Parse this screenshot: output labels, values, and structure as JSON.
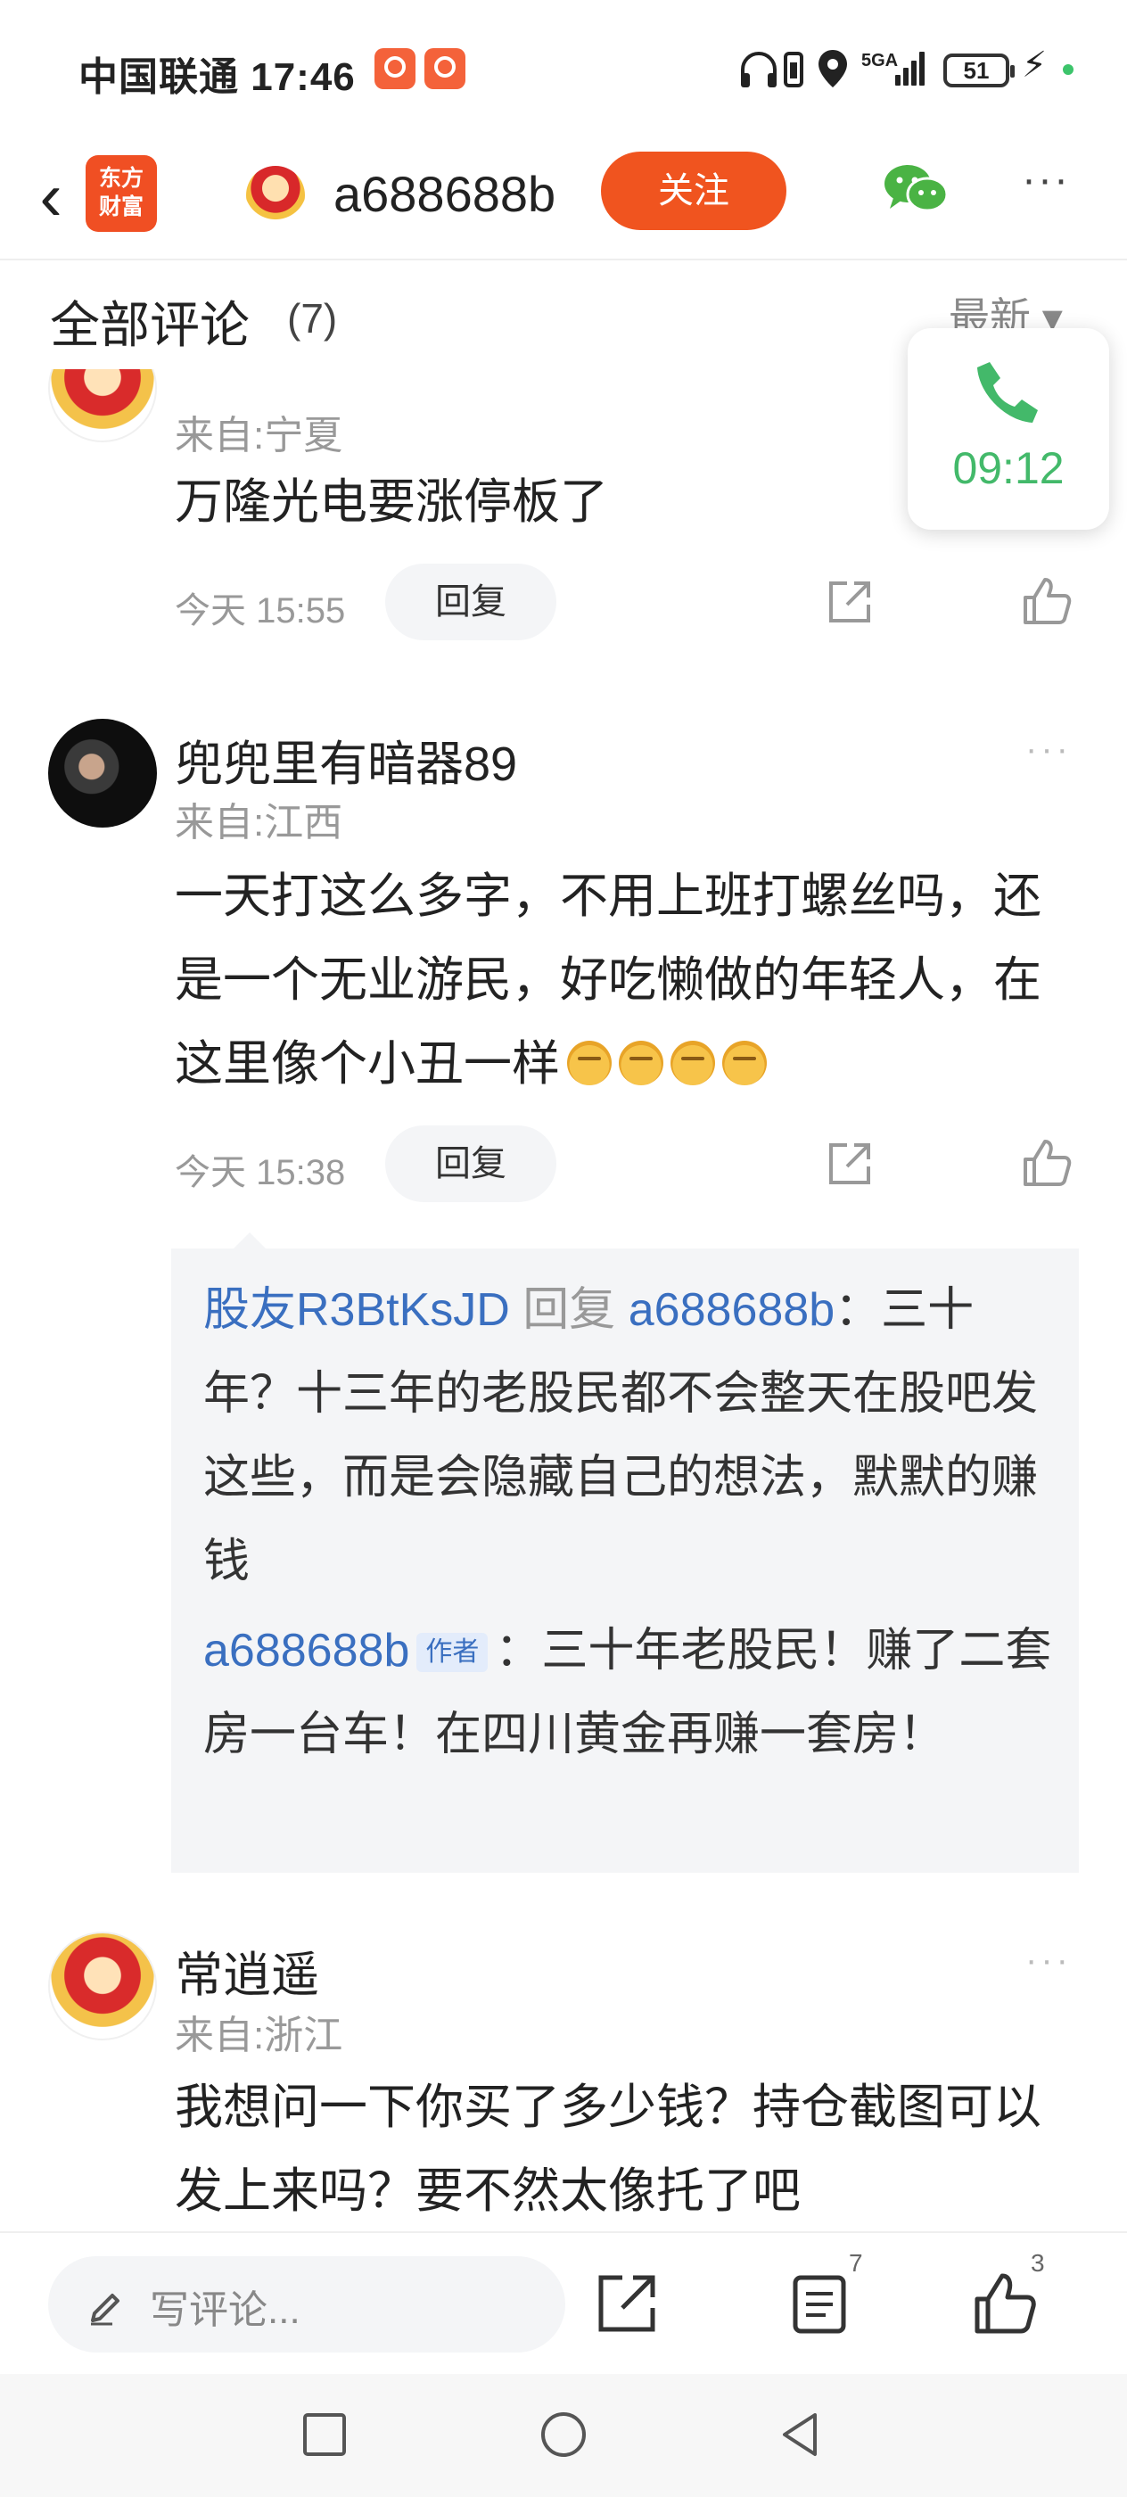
{
  "status_bar": {
    "carrier_time": "中国联通 17:46",
    "network": "5GA",
    "battery": "51",
    "bolt": "⚡"
  },
  "nav": {
    "back_glyph": "‹",
    "brand_logo": "东方\n财富",
    "host_name": "a688688b",
    "follow_label": "关注",
    "more_glyph": "···"
  },
  "comments_header": {
    "title": "全部评论",
    "count": "(7)",
    "sort": "最新 ▾"
  },
  "call_float": {
    "timer": "09:12",
    "accent": "#43b96a"
  },
  "comments": [
    {
      "username": "",
      "location": "来自:宁夏",
      "content": "万隆光电要涨停板了",
      "time": "今天 15:55",
      "reply_label": "回复"
    },
    {
      "username": "兜兜里有暗器89",
      "location": "来自:江西",
      "content": "一天打这么多字，不用上班打螺丝吗，还是一个无业游民，好吃懒做的年轻人，在这里像个小丑一样",
      "time": "今天 15:38",
      "reply_label": "回复",
      "more_glyph": "···",
      "replies": [
        {
          "from": "股友R3BtKsJD",
          "action": "回复",
          "to": "a688688b",
          "text": "：三十年？十三年的老股民都不会整天在股吧发这些，而是会隐藏自己的想法，默默的赚钱"
        },
        {
          "from": "a688688b",
          "tag": "作者",
          "text": "：三十年老股民！赚了二套房一台车！在四川黄金再赚一套房！"
        }
      ]
    },
    {
      "username": "常逍遥",
      "location": "来自:浙江",
      "content": "我想问一下你买了多少钱？持仓截图可以发上来吗？要不然太像托了吧",
      "more_glyph": "···"
    }
  ],
  "bottom_bar": {
    "input_placeholder": "写评论...",
    "comment_count": "7",
    "like_count": "3"
  },
  "colors": {
    "brand_orange": "#f0541f",
    "link_blue": "#3a6fc0",
    "call_green": "#43b96a"
  }
}
